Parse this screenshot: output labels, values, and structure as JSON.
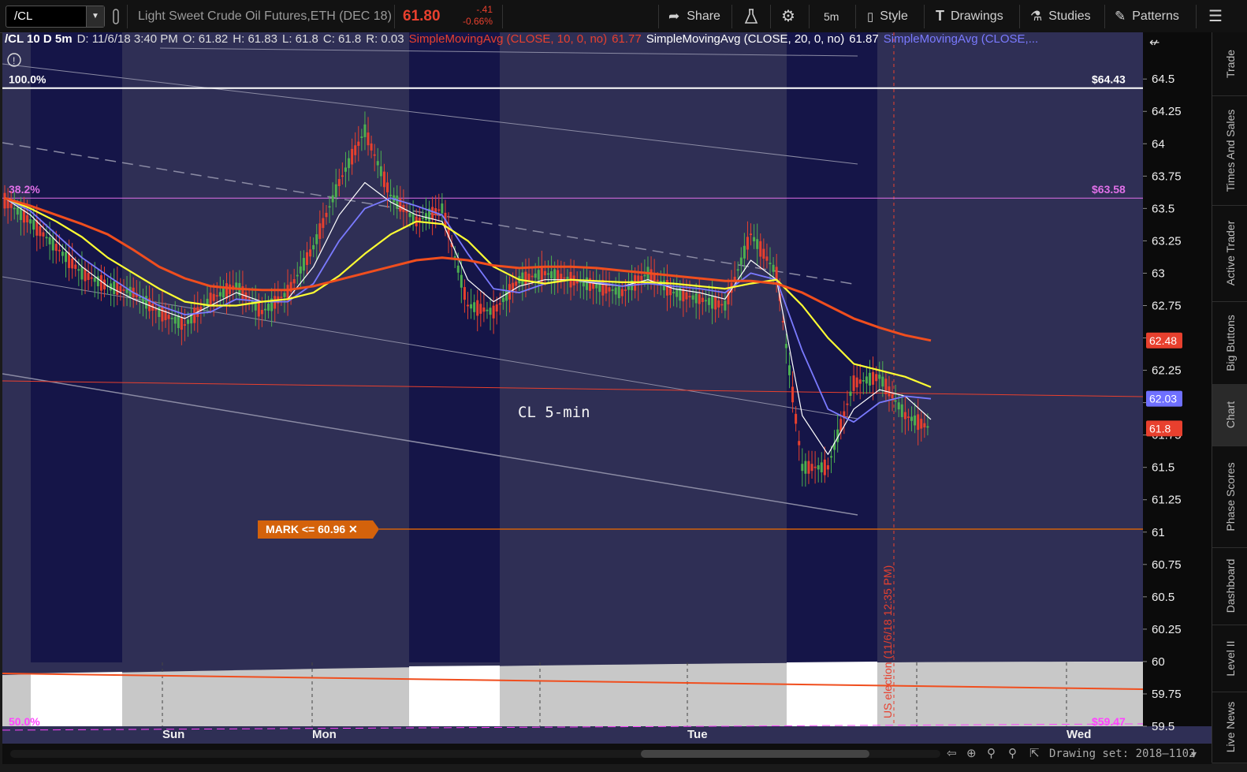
{
  "toolbar": {
    "symbol": "/CL",
    "instrument": "Light Sweet Crude Oil Futures,ETH (DEC 18)",
    "last_price": "61.80",
    "change": "-.41",
    "change_pct": "-0.66%",
    "share": "Share",
    "timeframe": "5m",
    "style": "Style",
    "drawings": "Drawings",
    "studies": "Studies",
    "patterns": "Patterns",
    "colors": {
      "negative": "#e8402e",
      "accent": "#d0d0d0"
    }
  },
  "header": {
    "symbol_period": "/CL 10 D 5m",
    "date": "D: 11/6/18 3:40 PM",
    "open": "O: 61.82",
    "high": "H: 61.83",
    "low": "L: 61.8",
    "close": "C: 61.8",
    "range": "R: 0.03",
    "sma10_label": "SimpleMovingAvg (CLOSE, 10, 0, no)",
    "sma10_value": "61.77",
    "sma20_label": "SimpleMovingAvg (CLOSE, 20, 0, no)",
    "sma20_value": "61.87",
    "sma50_label": "SimpleMovingAvg (CLOSE,..."
  },
  "sidebar": {
    "items": [
      "Trade",
      "Times And Sales",
      "Active Trader",
      "Big Buttons",
      "Chart",
      "Phase Scores",
      "Dashboard",
      "Level II",
      "Live News"
    ]
  },
  "footer": {
    "drawing_set": "Drawing set: 2018–1102"
  },
  "chart_data": {
    "type": "candlestick",
    "title": "CL 5-min",
    "x_labels": [
      "Sun",
      "Mon",
      "Tue",
      "Wed"
    ],
    "y_ticks": [
      "64.5",
      "64.25",
      "64",
      "63.75",
      "63.5",
      "63.25",
      "63",
      "62.75",
      "62.5",
      "62.25",
      "62",
      "61.75",
      "61.5",
      "61.25",
      "61",
      "60.75",
      "60.5",
      "60.25",
      "60",
      "59.75",
      "59.5"
    ],
    "ylim": [
      59.5,
      64.55
    ],
    "fib_levels": [
      {
        "label": "100.0%",
        "price_label": "$64.43",
        "value": 64.43,
        "color": "#ffffff"
      },
      {
        "label": "38.2%",
        "price_label": "$63.58",
        "value": 63.58,
        "color": "#e070e8"
      },
      {
        "label": "50.0%",
        "price_label": "$59.47",
        "value": 59.47,
        "color": "#ff44ff"
      }
    ],
    "mark": {
      "text": "MARK <= 60.96 ✕",
      "value": 60.96,
      "color": "#d4620b"
    },
    "event_label": "US election (11/6/18 12:35 PM)",
    "price_badges": [
      {
        "text": "62.48",
        "value": 62.48,
        "color": "#e8402e"
      },
      {
        "text": "62.03",
        "value": 62.03,
        "color": "#6f70ff"
      },
      {
        "text": "61.8",
        "value": 61.8,
        "color": "#e8402e"
      }
    ],
    "series": [
      {
        "name": "Close",
        "color": "#4caf50",
        "values": [
          63.56,
          63.4,
          63.2,
          63.0,
          62.9,
          62.85,
          62.7,
          62.6,
          62.8,
          62.9,
          62.7,
          62.85,
          63.2,
          63.7,
          64.1,
          63.6,
          63.4,
          63.5,
          62.75,
          62.7,
          62.95,
          63.0,
          62.95,
          62.9,
          62.85,
          63.0,
          62.85,
          62.8,
          62.75,
          63.3,
          63.0,
          61.5,
          61.5,
          62.15,
          62.2,
          61.9,
          61.8
        ]
      },
      {
        "name": "SMA10",
        "color": "#ffffff",
        "values": [
          63.58,
          63.45,
          63.25,
          63.05,
          62.9,
          62.8,
          62.72,
          62.65,
          62.75,
          62.85,
          62.78,
          62.8,
          63.05,
          63.45,
          63.7,
          63.55,
          63.45,
          63.4,
          62.95,
          62.78,
          62.9,
          62.95,
          62.95,
          62.92,
          62.9,
          62.95,
          62.88,
          62.85,
          62.8,
          63.1,
          62.95,
          61.9,
          61.6,
          61.95,
          62.1,
          62.05,
          61.87
        ]
      },
      {
        "name": "SMA20",
        "color": "#7a7aff",
        "values": [
          63.58,
          63.48,
          63.3,
          63.12,
          62.98,
          62.85,
          62.75,
          62.68,
          62.7,
          62.8,
          62.78,
          62.78,
          62.92,
          63.25,
          63.5,
          63.58,
          63.52,
          63.45,
          63.15,
          62.88,
          62.85,
          62.92,
          62.95,
          62.93,
          62.9,
          62.92,
          62.9,
          62.88,
          62.85,
          63.0,
          62.95,
          62.4,
          61.95,
          61.85,
          62.0,
          62.05,
          62.03
        ]
      },
      {
        "name": "SMA50",
        "color": "#ffff33",
        "values": [
          63.58,
          63.5,
          63.4,
          63.28,
          63.12,
          63.0,
          62.88,
          62.78,
          62.75,
          62.75,
          62.78,
          62.8,
          62.85,
          62.98,
          63.15,
          63.3,
          63.4,
          63.38,
          63.25,
          63.05,
          62.95,
          62.92,
          62.95,
          62.94,
          62.93,
          62.93,
          62.92,
          62.9,
          62.88,
          62.92,
          62.95,
          62.75,
          62.5,
          62.3,
          62.25,
          62.2,
          62.12
        ]
      },
      {
        "name": "SMA200",
        "color": "#f04e1e",
        "values": [
          63.58,
          63.52,
          63.45,
          63.38,
          63.3,
          63.18,
          63.05,
          62.96,
          62.9,
          62.88,
          62.87,
          62.87,
          62.9,
          62.95,
          63.0,
          63.05,
          63.1,
          63.12,
          63.1,
          63.06,
          63.04,
          63.05,
          63.05,
          63.04,
          63.02,
          63.0,
          62.98,
          62.96,
          62.94,
          62.94,
          62.92,
          62.85,
          62.75,
          62.65,
          62.58,
          62.52,
          62.48
        ]
      }
    ]
  }
}
